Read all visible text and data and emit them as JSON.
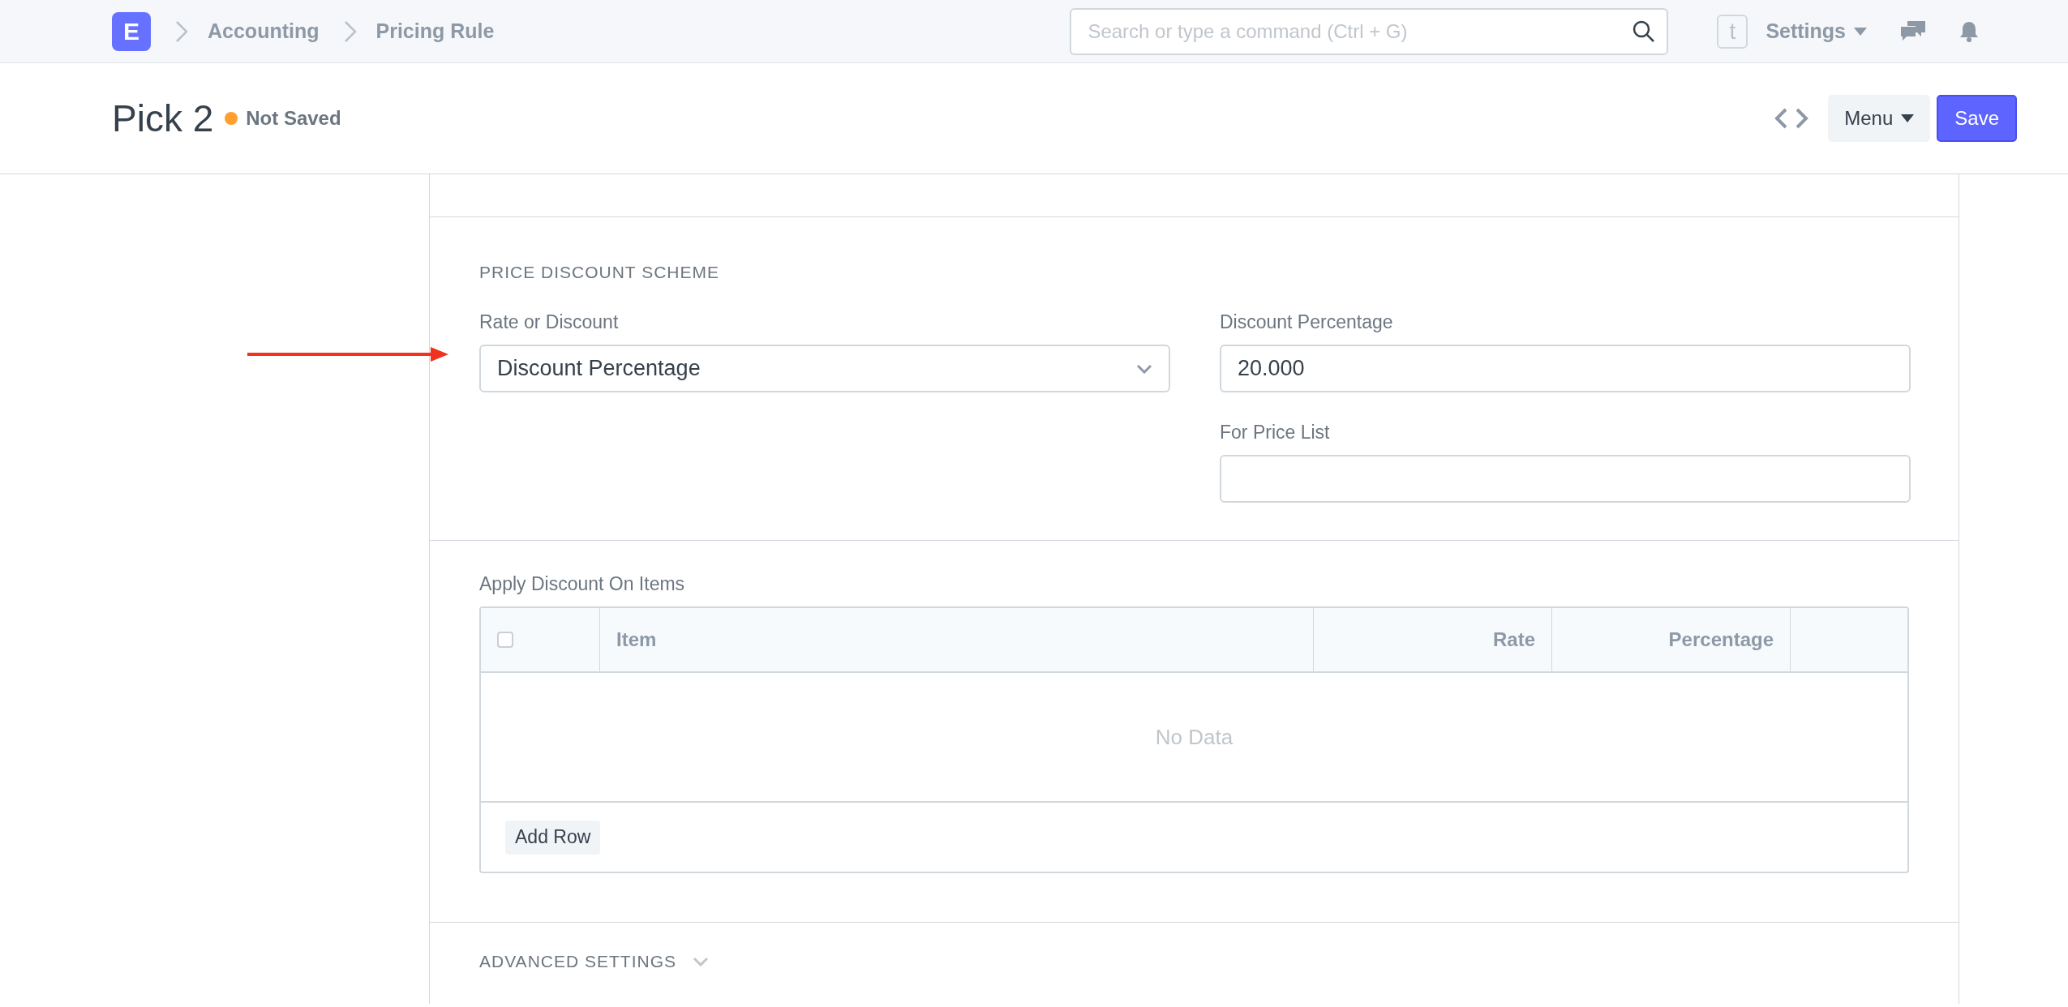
{
  "navbar": {
    "logo": "E",
    "breadcrumbs": [
      "Accounting",
      "Pricing Rule"
    ],
    "search": {
      "placeholder": "Search or type a command (Ctrl + G)"
    },
    "avatar": "t",
    "settings": "Settings"
  },
  "header": {
    "title": "Pick 2",
    "status": "Not Saved",
    "menu": "Menu",
    "save": "Save"
  },
  "section": {
    "heading": "PRICE DISCOUNT SCHEME",
    "left_fields": [
      {
        "label": "Rate or Discount",
        "kind": "select",
        "value": "Discount Percentage"
      }
    ],
    "right_fields": [
      {
        "label": "Discount Percentage",
        "kind": "input",
        "value": "20.000"
      },
      {
        "label": "For Price List",
        "kind": "input"
      }
    ]
  },
  "items_table": {
    "label": "Apply Discount On Items",
    "select_all": {
      "checked": false
    },
    "columns": [
      "Item",
      "Rate",
      "Percentage"
    ],
    "empty_text": "No Data",
    "add_button": "Add Row"
  },
  "advanced": {
    "heading": "ADVANCED SETTINGS",
    "expanded": false
  }
}
